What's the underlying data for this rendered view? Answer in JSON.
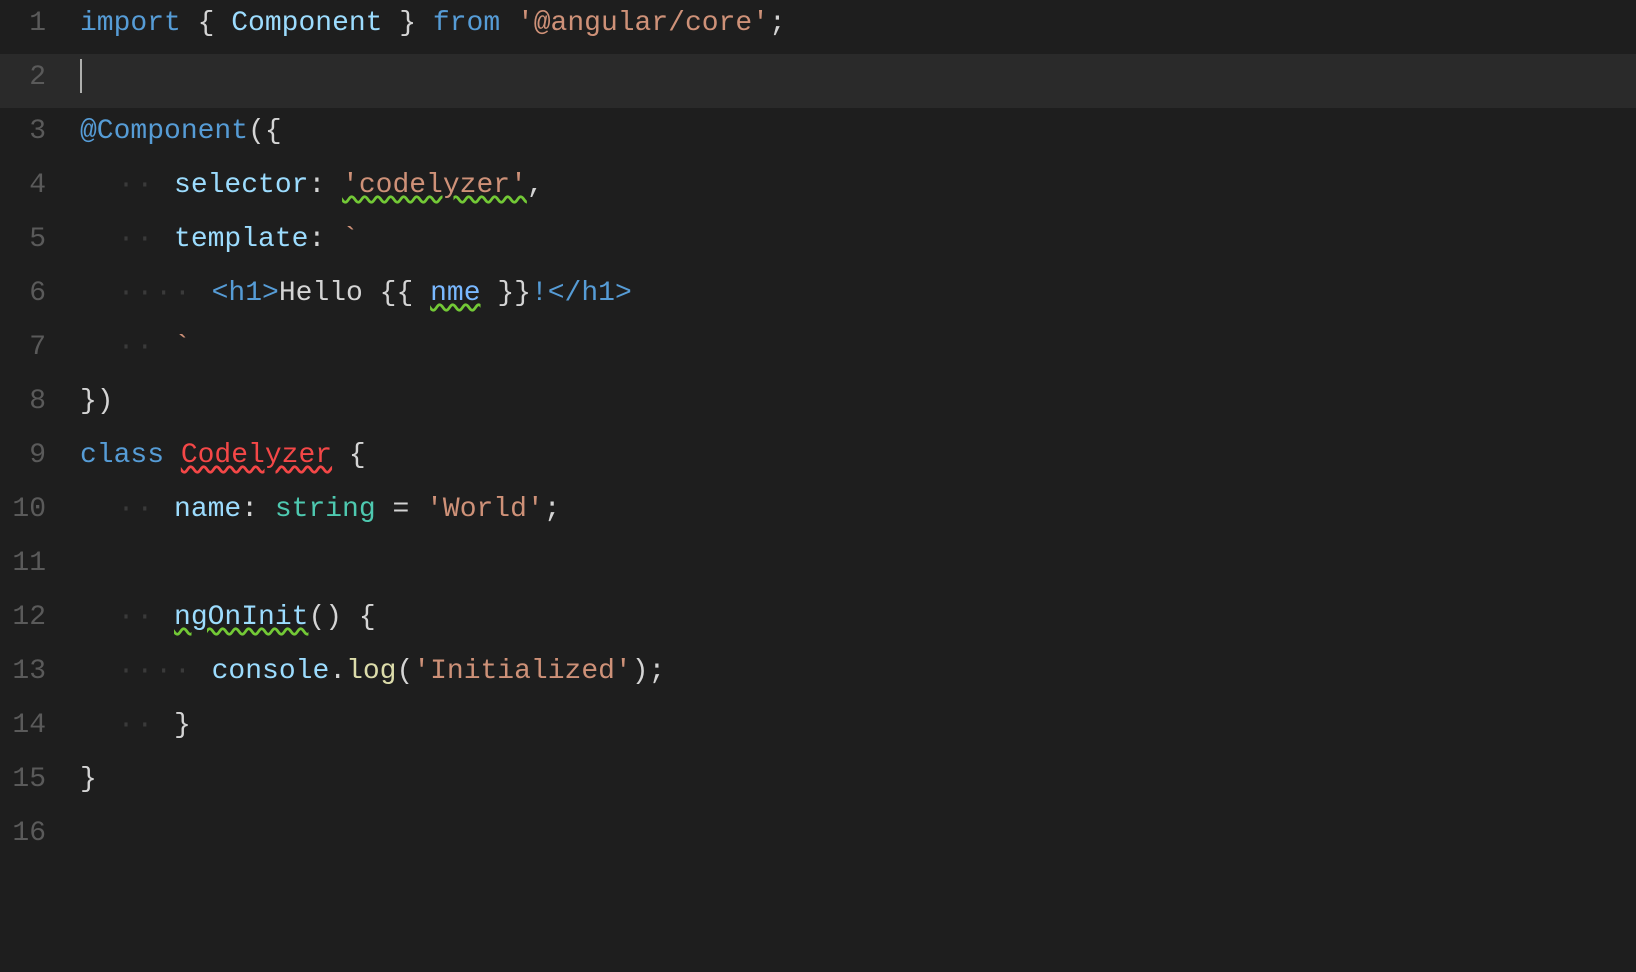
{
  "editor": {
    "background": "#1e1e1e",
    "lines": [
      {
        "number": 1,
        "tokens": [
          {
            "text": "import",
            "class": "kw-import"
          },
          {
            "text": " { ",
            "class": "kw-punc"
          },
          {
            "text": "Component",
            "class": "kw-white"
          },
          {
            "text": " } ",
            "class": "kw-punc"
          },
          {
            "text": "from",
            "class": "kw-from"
          },
          {
            "text": " ",
            "class": ""
          },
          {
            "text": "'@angular/core'",
            "class": "kw-module"
          },
          {
            "text": ";",
            "class": "kw-punc"
          }
        ]
      },
      {
        "number": 2,
        "tokens": []
      },
      {
        "number": 3,
        "tokens": [
          {
            "text": "@Component",
            "class": "kw-decorator"
          },
          {
            "text": "({",
            "class": "kw-punc"
          }
        ]
      },
      {
        "number": 4,
        "tokens": [
          {
            "text": "  ·· ",
            "class": "dot-indent"
          },
          {
            "text": "selector",
            "class": "kw-property"
          },
          {
            "text": ": ",
            "class": "kw-punc"
          },
          {
            "text": "'codelyzer'",
            "class": "kw-string wavy-green"
          },
          {
            "text": ",",
            "class": "kw-punc"
          }
        ]
      },
      {
        "number": 5,
        "tokens": [
          {
            "text": "  ·· ",
            "class": "dot-indent"
          },
          {
            "text": "template",
            "class": "kw-property"
          },
          {
            "text": ": ",
            "class": "kw-punc"
          },
          {
            "text": "`",
            "class": "kw-backtick"
          }
        ]
      },
      {
        "number": 6,
        "tokens": [
          {
            "text": "  ···· ",
            "class": "dot-indent"
          },
          {
            "text": "<h1>",
            "class": "kw-tag"
          },
          {
            "text": "Hello ",
            "class": "kw-punc"
          },
          {
            "text": "{{ ",
            "class": "kw-punc"
          },
          {
            "text": "nme",
            "class": "kw-angular wavy-green"
          },
          {
            "text": " }}",
            "class": "kw-punc"
          },
          {
            "text": "!</h1>",
            "class": "kw-tag"
          }
        ]
      },
      {
        "number": 7,
        "tokens": [
          {
            "text": "  ·· ",
            "class": "dot-indent"
          },
          {
            "text": "`",
            "class": "kw-backtick"
          }
        ]
      },
      {
        "number": 8,
        "tokens": [
          {
            "text": "})",
            "class": "kw-punc"
          }
        ]
      },
      {
        "number": 9,
        "tokens": [
          {
            "text": "class",
            "class": "kw-import"
          },
          {
            "text": " ",
            "class": ""
          },
          {
            "text": "Codelyzer",
            "class": "kw-classname wavy-red"
          },
          {
            "text": " {",
            "class": "kw-punc"
          }
        ]
      },
      {
        "number": 10,
        "tokens": [
          {
            "text": "  ·· ",
            "class": "dot-indent"
          },
          {
            "text": "name",
            "class": "kw-property"
          },
          {
            "text": ": ",
            "class": "kw-punc"
          },
          {
            "text": "string",
            "class": "kw-type"
          },
          {
            "text": " = ",
            "class": "kw-punc"
          },
          {
            "text": "'World'",
            "class": "kw-string"
          },
          {
            "text": ";",
            "class": "kw-punc"
          }
        ]
      },
      {
        "number": 11,
        "tokens": []
      },
      {
        "number": 12,
        "tokens": [
          {
            "text": "  ·· ",
            "class": "dot-indent"
          },
          {
            "text": "ngOnInit",
            "class": "kw-method wavy-green"
          },
          {
            "text": "() {",
            "class": "kw-punc"
          }
        ]
      },
      {
        "number": 13,
        "tokens": [
          {
            "text": "  ···· ",
            "class": "dot-indent"
          },
          {
            "text": "console",
            "class": "kw-console"
          },
          {
            "text": ".",
            "class": "kw-punc"
          },
          {
            "text": "log",
            "class": "kw-log"
          },
          {
            "text": "(",
            "class": "kw-punc"
          },
          {
            "text": "'Initialized'",
            "class": "kw-string"
          },
          {
            "text": ");",
            "class": "kw-punc"
          }
        ]
      },
      {
        "number": 14,
        "tokens": [
          {
            "text": "  ·· ",
            "class": "dot-indent"
          },
          {
            "text": "}",
            "class": "kw-punc"
          }
        ]
      },
      {
        "number": 15,
        "tokens": [
          {
            "text": "}",
            "class": "kw-punc"
          }
        ]
      },
      {
        "number": 16,
        "tokens": []
      }
    ],
    "cursor_line": 2,
    "cursor_position": 0
  }
}
